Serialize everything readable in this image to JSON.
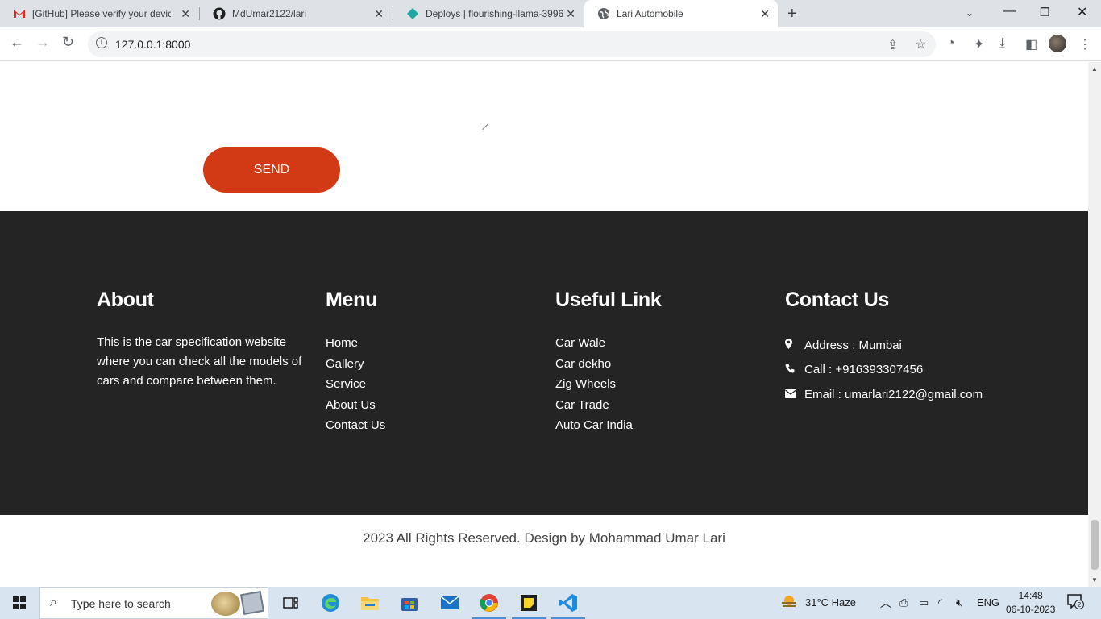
{
  "browser": {
    "tabs": [
      {
        "label": "[GitHub] Please verify your devic",
        "icon": "gmail-icon"
      },
      {
        "label": "MdUmar2122/lari",
        "icon": "github-icon"
      },
      {
        "label": "Deploys | flourishing-llama-3996",
        "icon": "netlify-icon"
      },
      {
        "label": "Lari Automobile",
        "icon": "globe-icon"
      }
    ],
    "url": "127.0.0.1:8000"
  },
  "form": {
    "send_label": "SEND"
  },
  "footer": {
    "about": {
      "title": "About",
      "text": "This is the car specification website where you can check all the models of cars and compare between them."
    },
    "menu": {
      "title": "Menu",
      "items": [
        "Home",
        "Gallery",
        "Service",
        "About Us",
        "Contact Us"
      ]
    },
    "useful": {
      "title": "Useful Link",
      "items": [
        "Car Wale",
        "Car dekho",
        "Zig Wheels",
        "Car Trade",
        "Auto Car India"
      ]
    },
    "contact": {
      "title": "Contact Us",
      "address": "Address : Mumbai",
      "call": "Call : +916393307456",
      "email": "Email : umarlari2122@gmail.com"
    },
    "copyright": "2023 All Rights Reserved. Design by Mohammad Umar Lari"
  },
  "taskbar": {
    "search_placeholder": "Type here to search",
    "weather": "31°C  Haze",
    "language": "ENG",
    "time": "14:48",
    "date": "06-10-2023",
    "notification_count": "2"
  },
  "colors": {
    "accent": "#d13a14",
    "footer_bg": "#242424"
  }
}
